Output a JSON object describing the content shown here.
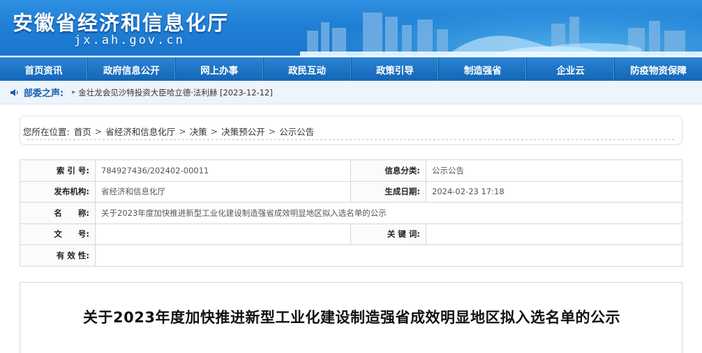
{
  "header": {
    "site_title": "安徽省经济和信息化厅",
    "domain": "jx.ah.gov.cn"
  },
  "nav": {
    "items": [
      "首页资讯",
      "政府信息公开",
      "网上办事",
      "政民互动",
      "政策引导",
      "制造强省",
      "企业云",
      "防疫物资保障"
    ]
  },
  "notice": {
    "icon": "speaker-icon",
    "label": "部委之声:",
    "text": "金壮龙会见沙特投资大臣哈立德·法利赫 [2023-12-12]"
  },
  "breadcrumb": {
    "prefix": "您所在位置:",
    "items": [
      "首页",
      "省经济和信息化厅",
      "决策",
      "决策预公开",
      "公示公告"
    ]
  },
  "info": {
    "index_label": "索 引 号:",
    "index_value": "784927436/202402-00011",
    "category_label": "信息分类:",
    "category_value": "公示公告",
    "publisher_label": "发布机构:",
    "publisher_value": "省经济和信息化厅",
    "date_label": "生成日期:",
    "date_value": "2024-02-23 17:18",
    "name_label": "名　　称:",
    "name_value": "关于2023年度加快推进新型工业化建设制造强省成效明显地区拟入选名单的公示",
    "docno_label": "文　　号:",
    "docno_value": "",
    "keywords_label": "关 键 词:",
    "keywords_value": "",
    "validity_label": "有 效 性:",
    "validity_value": ""
  },
  "article": {
    "title": "关于2023年度加快推进新型工业化建设制造强省成效明显地区拟入选名单的公示"
  },
  "colors": {
    "banner_blue": "#1f7fd6",
    "nav_blue": "#1466b6",
    "notice_label": "#1a5fb4"
  }
}
